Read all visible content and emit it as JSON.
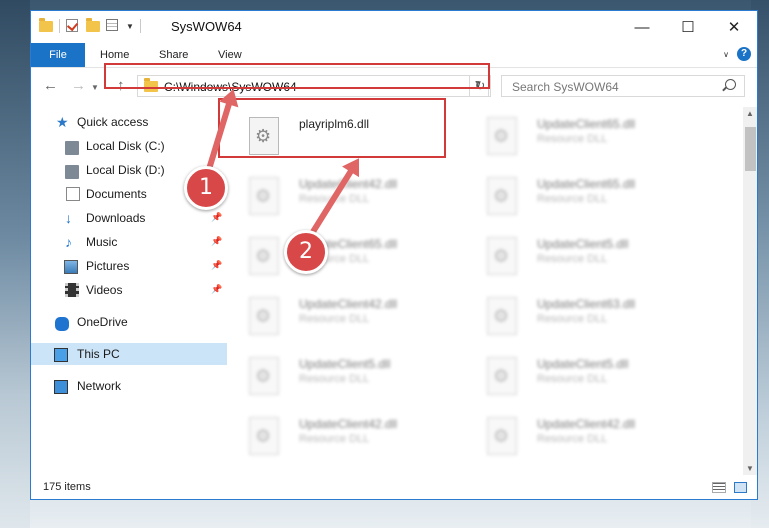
{
  "window": {
    "title": "SysWOW64",
    "controls": {
      "minimize": "—",
      "maximize": "☐",
      "close": "✕"
    }
  },
  "ribbon": {
    "tabs": [
      {
        "label": "File"
      },
      {
        "label": "Home"
      },
      {
        "label": "Share"
      },
      {
        "label": "View"
      }
    ]
  },
  "address_bar": {
    "path": "C:\\Windows\\SysWOW64",
    "search_placeholder": "Search SysWOW64"
  },
  "sidebar": {
    "items": [
      {
        "label": "Quick access",
        "icon": "star-icon"
      },
      {
        "label": "Local Disk (C:)",
        "icon": "drive-icon"
      },
      {
        "label": "Local Disk (D:)",
        "icon": "drive-icon"
      },
      {
        "label": "Documents",
        "icon": "documents-icon",
        "pinned": false
      },
      {
        "label": "Downloads",
        "icon": "download-icon",
        "pinned": true
      },
      {
        "label": "Music",
        "icon": "music-icon",
        "pinned": true
      },
      {
        "label": "Pictures",
        "icon": "pictures-icon",
        "pinned": true
      },
      {
        "label": "Videos",
        "icon": "videos-icon",
        "pinned": true
      },
      {
        "label": "OneDrive",
        "icon": "onedrive-icon"
      },
      {
        "label": "This PC",
        "icon": "pc-icon",
        "selected": true
      },
      {
        "label": "Network",
        "icon": "network-icon"
      }
    ]
  },
  "files": {
    "highlighted": {
      "name": "playriplm6.dll"
    },
    "items": [
      {
        "name": "UpdateClient65.dll",
        "type": "Resource DLL"
      },
      {
        "name": "UpdateClient42.dll",
        "type": "Resource DLL"
      },
      {
        "name": "UpdateClient65.dll",
        "type": "Resource DLL"
      },
      {
        "name": "UpdateClient65.dll",
        "type": "Resource DLL"
      },
      {
        "name": "UpdateClient5.dll",
        "type": "Resource DLL"
      },
      {
        "name": "UpdateClient42.dll",
        "type": "Resource DLL"
      },
      {
        "name": "UpdateClient63.dll",
        "type": "Resource DLL"
      },
      {
        "name": "UpdateClient5.dll",
        "type": "Resource DLL"
      },
      {
        "name": "UpdateClient5.dll",
        "type": "Resource DLL"
      },
      {
        "name": "UpdateClient42.dll",
        "type": "Resource DLL"
      },
      {
        "name": "UpdateClient42.dll",
        "type": "Resource DLL"
      }
    ]
  },
  "status": {
    "item_count": "175 items"
  },
  "annotations": {
    "step1": "1",
    "step2": "2",
    "color": "#d23a3a"
  }
}
